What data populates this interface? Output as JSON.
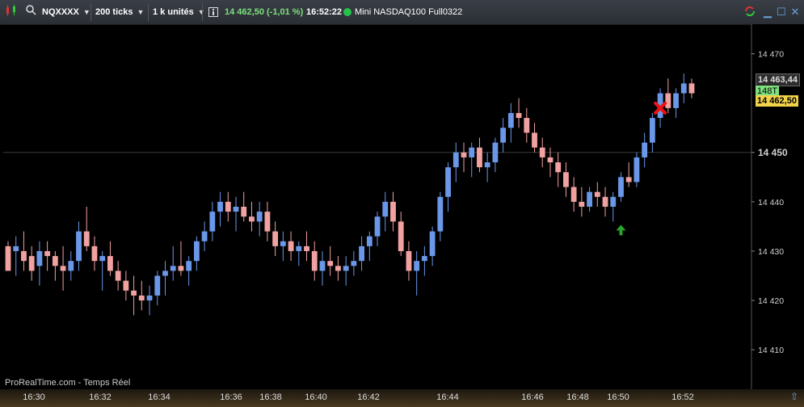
{
  "toolbar": {
    "symbol": "NQXXXX",
    "ticks": "200 ticks",
    "units": "1 k unités",
    "price_change": "14 462,50 (-1,01 %)",
    "time": "16:52:22",
    "instrument": "Mini NASDAQ100 Full0322"
  },
  "colors": {
    "up": "#6a97e8",
    "down": "#f2a1a1",
    "grid": "#2b2b2b",
    "axis": "#cfcfcf"
  },
  "price_axis": {
    "ticks": [
      "14 470",
      "14 450",
      "14 440",
      "14 430",
      "14 420",
      "14 410"
    ],
    "bold_tick": "14 450",
    "current_high": "14 463,44",
    "last": "14 462,50",
    "tick_label": "148T"
  },
  "x_axis": {
    "ticks": [
      "16:30",
      "16:32",
      "16:34",
      "16:36",
      "16:38",
      "16:40",
      "16:42",
      "16:44",
      "16:46",
      "16:48",
      "16:50",
      "16:52"
    ]
  },
  "watermark": "ProRealTime.com - Temps Réel",
  "chart_data": {
    "type": "candlestick",
    "ylim": [
      14402,
      14476
    ],
    "candles": [
      [
        14431,
        14432,
        14427,
        14426,
        0
      ],
      [
        14431,
        14433,
        14425,
        14430,
        1
      ],
      [
        14430,
        14434,
        14426,
        14428,
        0
      ],
      [
        14429,
        14431,
        14424,
        14426,
        0
      ],
      [
        14427,
        14432,
        14423,
        14430,
        1
      ],
      [
        14430,
        14432,
        14426,
        14429,
        0
      ],
      [
        14429,
        14430,
        14424,
        14427,
        0
      ],
      [
        14427,
        14431,
        14422,
        14426,
        0
      ],
      [
        14426,
        14430,
        14424,
        14428,
        1
      ],
      [
        14428,
        14436,
        14426,
        14434,
        1
      ],
      [
        14434,
        14439,
        14430,
        14431,
        0
      ],
      [
        14431,
        14433,
        14426,
        14428,
        0
      ],
      [
        14428,
        14430,
        14422,
        14429,
        1
      ],
      [
        14429,
        14432,
        14425,
        14426,
        0
      ],
      [
        14426,
        14428,
        14422,
        14424,
        0
      ],
      [
        14424,
        14426,
        14420,
        14422,
        0
      ],
      [
        14422,
        14425,
        14417,
        14421,
        0
      ],
      [
        14421,
        14424,
        14418,
        14420,
        0
      ],
      [
        14420,
        14423,
        14417,
        14421,
        1
      ],
      [
        14421,
        14426,
        14419,
        14425,
        1
      ],
      [
        14425,
        14428,
        14421,
        14426,
        1
      ],
      [
        14426,
        14431,
        14424,
        14427,
        1
      ],
      [
        14427,
        14432,
        14425,
        14426,
        0
      ],
      [
        14426,
        14429,
        14423,
        14428,
        1
      ],
      [
        14428,
        14433,
        14426,
        14432,
        1
      ],
      [
        14432,
        14436,
        14430,
        14434,
        1
      ],
      [
        14434,
        14440,
        14432,
        14438,
        1
      ],
      [
        14438,
        14442,
        14435,
        14440,
        1
      ],
      [
        14440,
        14442,
        14436,
        14438,
        0
      ],
      [
        14438,
        14441,
        14434,
        14439,
        1
      ],
      [
        14439,
        14442,
        14436,
        14437,
        0
      ],
      [
        14437,
        14440,
        14434,
        14436,
        0
      ],
      [
        14436,
        14440,
        14433,
        14438,
        1
      ],
      [
        14438,
        14440,
        14432,
        14434,
        0
      ],
      [
        14434,
        14436,
        14429,
        14431,
        0
      ],
      [
        14431,
        14434,
        14428,
        14432,
        1
      ],
      [
        14432,
        14434,
        14428,
        14430,
        0
      ],
      [
        14430,
        14432,
        14427,
        14431,
        1
      ],
      [
        14431,
        14434,
        14428,
        14430,
        0
      ],
      [
        14430,
        14432,
        14424,
        14426,
        0
      ],
      [
        14426,
        14430,
        14423,
        14428,
        1
      ],
      [
        14428,
        14431,
        14425,
        14427,
        0
      ],
      [
        14427,
        14429,
        14424,
        14426,
        0
      ],
      [
        14426,
        14429,
        14423,
        14427,
        1
      ],
      [
        14427,
        14430,
        14425,
        14428,
        1
      ],
      [
        14428,
        14433,
        14426,
        14431,
        1
      ],
      [
        14431,
        14434,
        14428,
        14433,
        1
      ],
      [
        14433,
        14438,
        14431,
        14437,
        1
      ],
      [
        14437,
        14442,
        14434,
        14440,
        1
      ],
      [
        14440,
        14442,
        14434,
        14436,
        0
      ],
      [
        14436,
        14438,
        14429,
        14430,
        0
      ],
      [
        14430,
        14432,
        14424,
        14426,
        0
      ],
      [
        14426,
        14430,
        14421,
        14428,
        1
      ],
      [
        14428,
        14431,
        14425,
        14429,
        1
      ],
      [
        14429,
        14435,
        14427,
        14434,
        1
      ],
      [
        14434,
        14442,
        14432,
        14441,
        1
      ],
      [
        14441,
        14448,
        14438,
        14447,
        1
      ],
      [
        14447,
        14452,
        14444,
        14450,
        1
      ],
      [
        14450,
        14452,
        14446,
        14449,
        0
      ],
      [
        14449,
        14452,
        14445,
        14451,
        1
      ],
      [
        14451,
        14453,
        14446,
        14447,
        0
      ],
      [
        14447,
        14450,
        14444,
        14448,
        1
      ],
      [
        14448,
        14453,
        14446,
        14452,
        1
      ],
      [
        14452,
        14457,
        14450,
        14455,
        1
      ],
      [
        14455,
        14460,
        14452,
        14458,
        1
      ],
      [
        14458,
        14461,
        14455,
        14457,
        0
      ],
      [
        14457,
        14459,
        14452,
        14454,
        0
      ],
      [
        14454,
        14456,
        14450,
        14451,
        0
      ],
      [
        14451,
        14453,
        14447,
        14449,
        0
      ],
      [
        14449,
        14451,
        14445,
        14448,
        0
      ],
      [
        14448,
        14450,
        14443,
        14446,
        0
      ],
      [
        14446,
        14448,
        14441,
        14443,
        0
      ],
      [
        14443,
        14445,
        14438,
        14440,
        0
      ],
      [
        14440,
        14443,
        14437,
        14439,
        0
      ],
      [
        14439,
        14443,
        14438,
        14442,
        1
      ],
      [
        14442,
        14444,
        14439,
        14441,
        0
      ],
      [
        14441,
        14443,
        14437,
        14439,
        0
      ],
      [
        14439,
        14442,
        14436,
        14441,
        1
      ],
      [
        14441,
        14446,
        14440,
        14445,
        1
      ],
      [
        14445,
        14448,
        14443,
        14444,
        0
      ],
      [
        14444,
        14450,
        14443,
        14449,
        1
      ],
      [
        14449,
        14454,
        14447,
        14452,
        1
      ],
      [
        14452,
        14458,
        14450,
        14457,
        1
      ],
      [
        14457,
        14463,
        14455,
        14462,
        1
      ],
      [
        14462,
        14465,
        14458,
        14459,
        0
      ],
      [
        14459,
        14463,
        14457,
        14462,
        1
      ],
      [
        14462,
        14466,
        14460,
        14464,
        1
      ],
      [
        14464,
        14465,
        14461,
        14462,
        0
      ]
    ],
    "markers": [
      {
        "type": "buy-arrow",
        "index": 78,
        "price": 14436
      },
      {
        "type": "exit-cross",
        "index": 83,
        "price": 14459
      }
    ]
  }
}
